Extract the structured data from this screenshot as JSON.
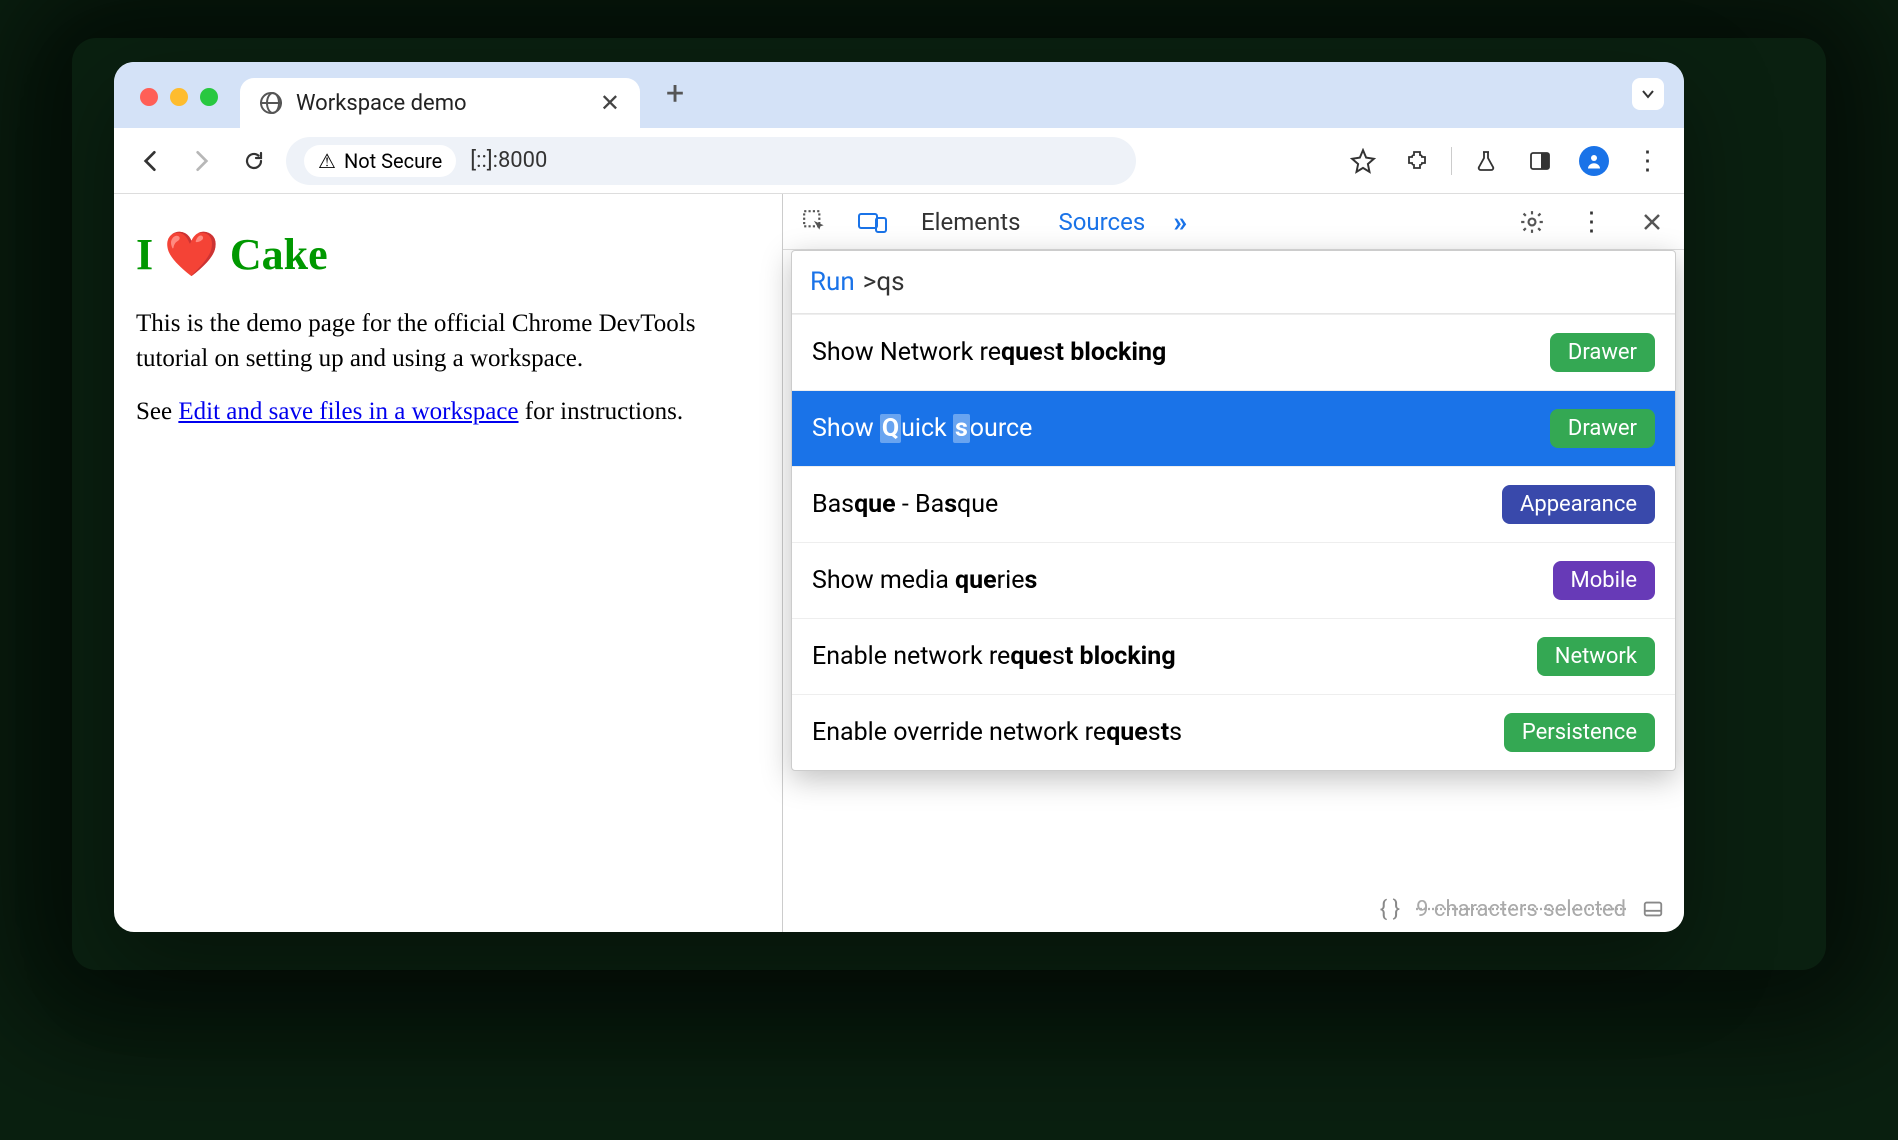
{
  "browser": {
    "tab_title": "Workspace demo",
    "not_secure_label": "Not Secure",
    "url": "[::]:8000",
    "traffic_colors": {
      "close": "#ff5f57",
      "min": "#febc2e",
      "max": "#28c840"
    }
  },
  "page": {
    "heading": "I ❤️ Cake",
    "paragraph": "This is the demo page for the official Chrome DevTools tutorial on setting up and using a workspace.",
    "see_prefix": "See ",
    "link_text": "Edit and save files in a workspace",
    "see_suffix": " for instructions."
  },
  "devtools": {
    "tabs": {
      "elements": "Elements",
      "sources": "Sources"
    },
    "command_menu": {
      "prompt_label": "Run",
      "query": ">qs",
      "items": [
        {
          "text_parts": [
            "Show Network re",
            "que",
            "s",
            "t blocking"
          ],
          "badge": "Drawer",
          "badge_color": "#34a853",
          "selected": false
        },
        {
          "text_parts": [
            "Show ",
            "Q",
            "uick ",
            "s",
            "ource"
          ],
          "badge": "Drawer",
          "badge_color": "#34a853",
          "selected": true
        },
        {
          "text_parts": [
            "Bas",
            "que",
            " - Ba",
            "s",
            "que"
          ],
          "badge": "Appearance",
          "badge_color": "#3949ab",
          "selected": false
        },
        {
          "text_parts": [
            "Show media ",
            "que",
            "rie",
            "s",
            ""
          ],
          "badge": "Mobile",
          "badge_color": "#673ab7",
          "selected": false
        },
        {
          "text_parts": [
            "Enable network re",
            "que",
            "s",
            "t blocking"
          ],
          "badge": "Network",
          "badge_color": "#34a853",
          "selected": false
        },
        {
          "text_parts": [
            "Enable override network re",
            "que",
            "s",
            "t",
            "s"
          ],
          "badge": "Persistence",
          "badge_color": "#34a853",
          "selected": false
        }
      ]
    },
    "footer_text": "9 characters selected"
  }
}
